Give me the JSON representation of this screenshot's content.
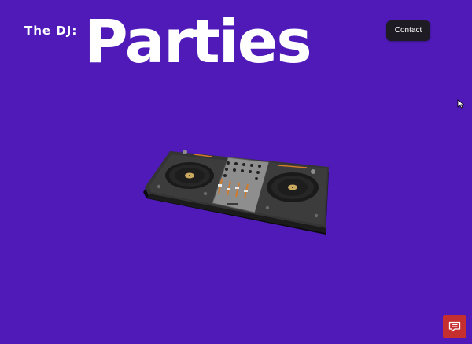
{
  "header": {
    "prefix": "The DJ:",
    "headline": "Parties",
    "contact_label": "Contact"
  },
  "illustration": {
    "name": "dj-controller"
  },
  "chat_widget": {
    "icon": "chat-icon"
  },
  "colors": {
    "background": "#4f1ab8",
    "text": "#ffffff",
    "button": "#1f1b24",
    "chat_button": "#c62f2f"
  }
}
